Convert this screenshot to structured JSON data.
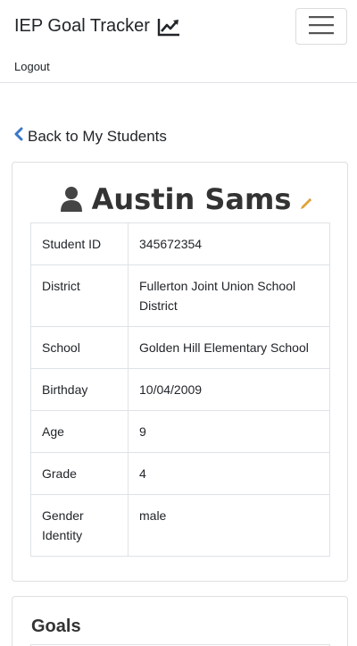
{
  "navbar": {
    "brand": "IEP Goal Tracker",
    "brand_icon": "line-chart-icon",
    "menu_icon": "hamburger-menu-icon",
    "logout": "Logout"
  },
  "back_link": {
    "icon": "chevron-left-icon",
    "label": "Back to My Students"
  },
  "student": {
    "icon": "user-icon",
    "name": "Austin Sams",
    "edit_icon": "pencil-icon",
    "fields": [
      {
        "label": "Student ID",
        "value": "345672354"
      },
      {
        "label": "District",
        "value": "Fullerton Joint Union School District"
      },
      {
        "label": "School",
        "value": "Golden Hill Elementary School"
      },
      {
        "label": "Birthday",
        "value": "10/04/2009"
      },
      {
        "label": "Age",
        "value": "9"
      },
      {
        "label": "Grade",
        "value": "4"
      },
      {
        "label": "Gender Identity",
        "value": "male"
      }
    ]
  },
  "goals": {
    "title": "Goals"
  },
  "colors": {
    "link_icon": "#3a78c9",
    "edit_icon": "#e0a43a",
    "text": "#212529",
    "border": "#dee2e6"
  }
}
